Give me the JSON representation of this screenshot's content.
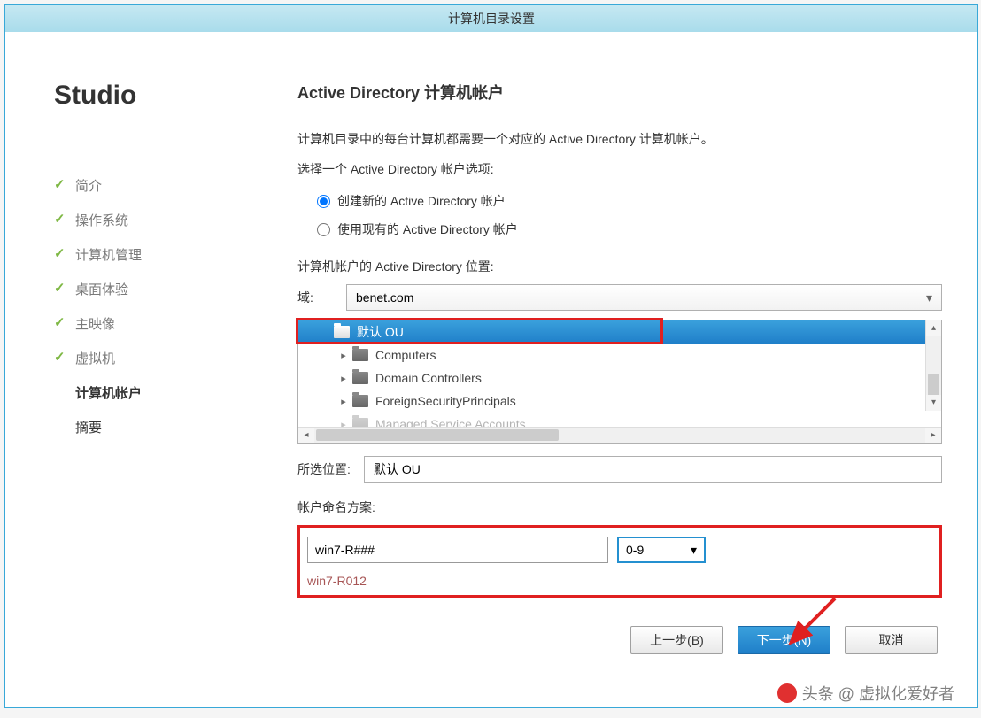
{
  "window": {
    "title": "计算机目录设置"
  },
  "brand": "Studio",
  "steps": [
    {
      "label": "简介",
      "state": "done"
    },
    {
      "label": "操作系统",
      "state": "done"
    },
    {
      "label": "计算机管理",
      "state": "done"
    },
    {
      "label": "桌面体验",
      "state": "done"
    },
    {
      "label": "主映像",
      "state": "done"
    },
    {
      "label": "虚拟机",
      "state": "done"
    },
    {
      "label": "计算机帐户",
      "state": "current"
    },
    {
      "label": "摘要",
      "state": "pending"
    }
  ],
  "page": {
    "title": "Active Directory 计算机帐户",
    "desc": "计算机目录中的每台计算机都需要一个对应的 Active Directory 计算机帐户。",
    "option_prompt": "选择一个 Active Directory 帐户选项:",
    "radio_create": "创建新的 Active Directory 帐户",
    "radio_existing": "使用现有的 Active Directory 帐户",
    "location_label": "计算机帐户的 Active Directory 位置:",
    "domain_label": "域:",
    "domain_value": "benet.com",
    "tree": {
      "default_ou": "默认 OU",
      "items": [
        "Computers",
        "Domain Controllers",
        "ForeignSecurityPrincipals",
        "Managed Service Accounts"
      ]
    },
    "selected_label": "所选位置:",
    "selected_value": "默认 OU",
    "naming_label": "帐户命名方案:",
    "naming_value": "win7-R###",
    "suffix_value": "0-9",
    "preview": "win7-R012"
  },
  "buttons": {
    "back": "上一步(B)",
    "next": "下一步(N)",
    "cancel": "取消"
  },
  "watermark": "头条 @ 虚拟化爱好者"
}
